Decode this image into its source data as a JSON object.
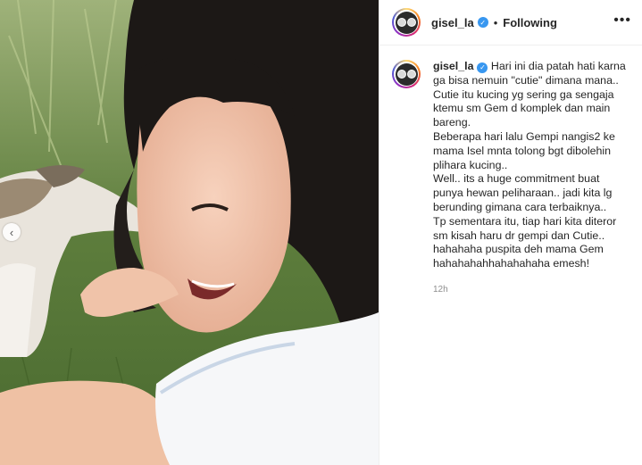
{
  "post": {
    "username": "gisel_la",
    "verified_icon": "verified-badge-icon",
    "separator": "•",
    "follow_status": "Following",
    "more_icon": "more-options-icon",
    "caption": {
      "first_line": "Hari ini dia patah hati karna ga bisa nemuin \"cutie\" dimana mana.. Cutie itu kucing yg sering ga sengaja ktemu sm Gem d komplek dan main bareng.",
      "para2": "Beberapa hari lalu Gempi nangis2 ke mama Isel mnta tolong bgt dibolehin plihara kucing..",
      "para3": "Well.. its a huge commitment buat punya hewan peliharaan.. jadi kita lg berunding gimana cara terbaiknya..",
      "para4": "Tp sementara itu, tiap hari kita diteror sm kisah haru dr gempi dan Cutie..",
      "para5": "hahahaha puspita deh mama Gem",
      "para6": "hahahahahhahahahaha emesh!"
    },
    "timestamp": "12h"
  },
  "media": {
    "prev_arrow": "‹"
  }
}
